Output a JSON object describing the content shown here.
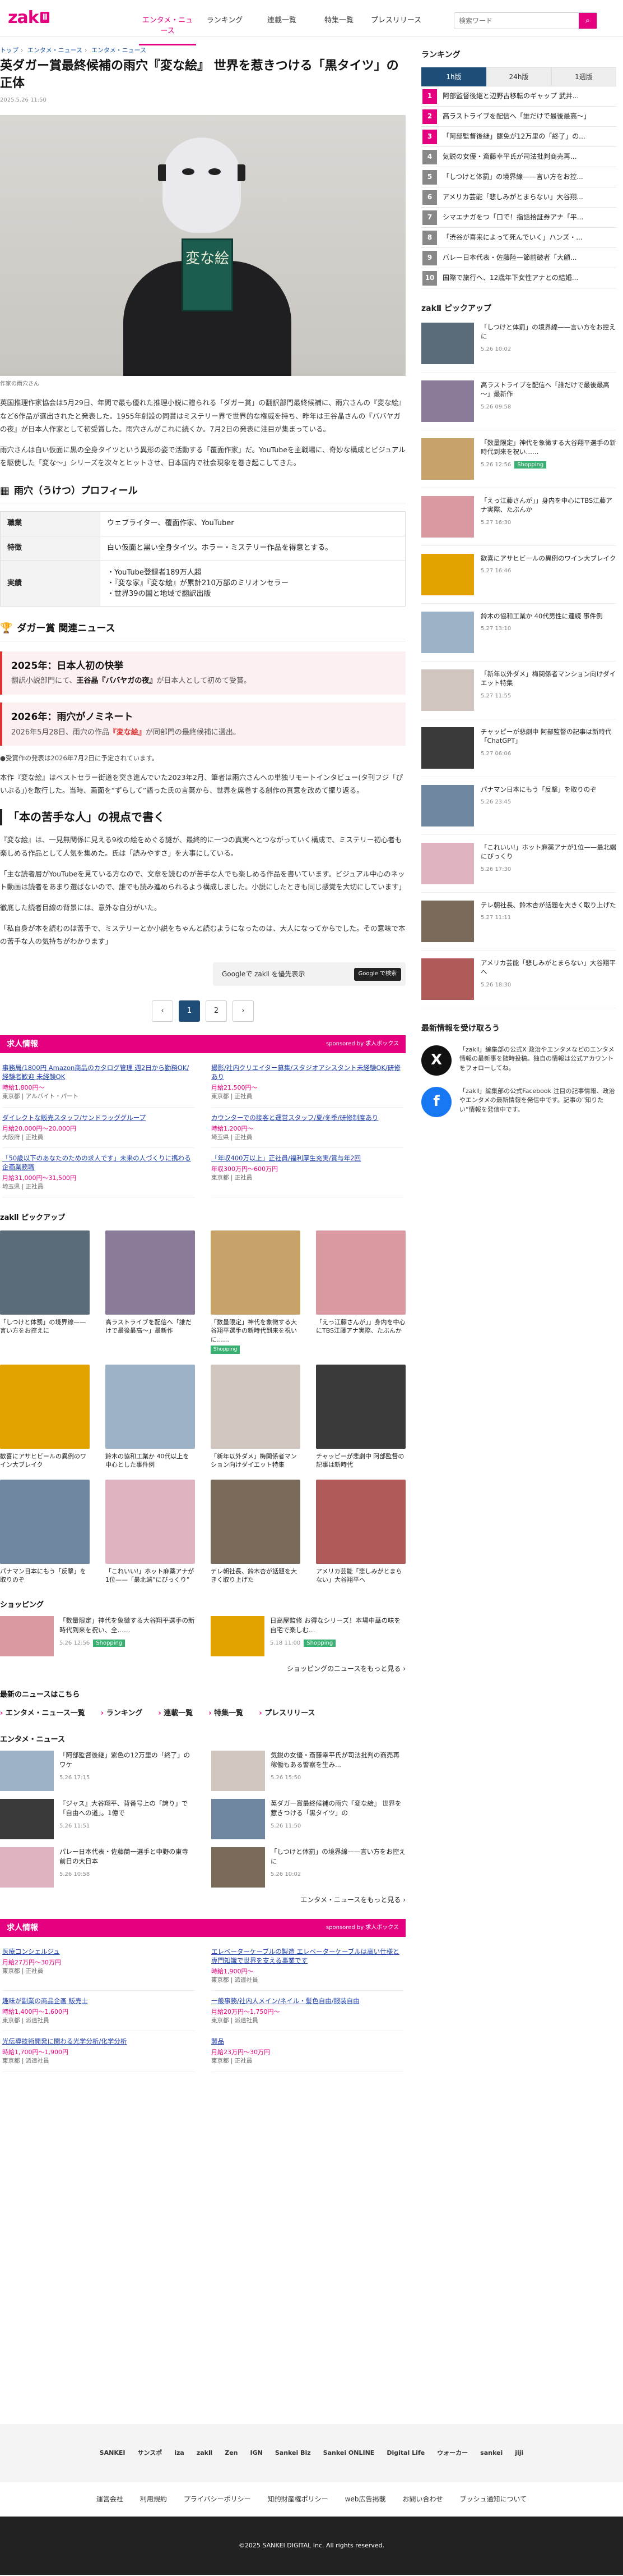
{
  "header": {
    "logo": "zak",
    "logo_box": "Ⅱ",
    "nav": [
      "エンタメ・ニュース",
      "ランキング",
      "連載一覧",
      "特集一覧",
      "プレスリリース"
    ],
    "search_placeholder": "検索ワード",
    "search_icon": "search-icon"
  },
  "breadcrumb": [
    "トップ",
    "エンタメ・ニュース",
    "エンタメ・ニュース"
  ],
  "article": {
    "title": "英ダガー賞最終候補の雨穴『変な絵』 世界を惹きつける「黒タイツ」の正体",
    "date": "2025.5.26 11:50",
    "photo_book_text": "変な絵",
    "photo_caption": "作家の雨穴さん",
    "lead": "英国推理作家協会は5月29日、年間で最も優れた推理小説に贈られる「ダガー賞」の翻訳部門最終候補に、雨穴さんの『変な絵』など6作品が選出されたと発表した。1955年創設の同賞はミステリー界で世界的な権威を持ち、昨年は王谷晶さんの『ババヤガの夜』が日本人作家として初受賞した。雨穴さんがこれに続くか。7月2日の発表に注目が集まっている。",
    "lead2": "雨穴さんは白い仮面に黒の全身タイツという異形の姿で活動する「覆面作家」だ。YouTubeを主戦場に、奇妙な構成とビジュアルを駆使した「変な〜」シリーズを次々とヒットさせ、日本国内で社会現象を巻き起こしてきた。",
    "profile_heading": "雨穴（うけつ）プロフィール",
    "profile": [
      {
        "k": "職業",
        "v": [
          "ウェブライター、覆面作家、YouTuber"
        ]
      },
      {
        "k": "特徴",
        "v": [
          "白い仮面と黒い全身タイツ。ホラー・ミステリー作品を得意とする。"
        ]
      },
      {
        "k": "実績",
        "v": [
          "・YouTube登録者189万人超",
          "・『変な家』『変な絵』が累計210万部のミリオンセラー",
          "・世界39の国と地域で翻訳出版"
        ]
      }
    ],
    "related_heading": "ダガー賞 関連ニュース",
    "news": [
      {
        "h": "2025年：日本人初の快挙",
        "t1": "翻訳小説部門にて、",
        "b": "王谷晶『ババヤガの夜』",
        "t2": "が日本人として初めて受賞。"
      },
      {
        "h": "2026年：雨穴がノミネート",
        "t1": "2026年5月28日、雨穴の作品",
        "b": "『変な絵』",
        "t2": "が同部門の最終候補に選出。"
      }
    ],
    "note": "●受賞作の発表は2026年7月2日に予定されています。",
    "para3": "本作『変な絵』はベストセラー街道を突き進んでいた2023年2月、筆者は雨穴さんへの単独リモートインタビュー(タ刊フジ「ぴいぷる」)を敢行した。当時、画面を“ずらして”語った氏の言葉から、世界を席巻する創作の真意を改めて振り返る。",
    "h2": "「本の苦手な人」の視点で書く",
    "para4": "『変な絵』は、一見無関係に見える9枚の絵をめぐる謎が、最終的に一つの真実へとつながっていく構成で、ミステリー初心者も楽しめる作品として人気を集めた。氏は「読みやすさ」を大事にしている。",
    "para5": "「主な読者層がYouTubeを見ている方なので、文章を読むのが苦手な人でも楽しめる作品を書いています。ビジュアル中心のネット動画は読者をあまり選ばないので、誰でも読み進められるよう構成しました。小説にしたときも同じ感覚を大切にしています」",
    "para6": "徹底した読者目線の背景には、意外な自分がいた。",
    "para7": "「私自身が本を読むのは苦手で、ミステリーとか小説をちゃんと読むようになったのは、大人になってからでした。その意味で本の苦手な人の気持ちがわかります」",
    "google_label": "Googleで zakⅡ を優先表示",
    "google_btn": "Google で検索",
    "pages": [
      "‹",
      "1",
      "2",
      "›"
    ]
  },
  "jobs1": {
    "title": "求人情報",
    "sponsor": "sponsored by 求人ボックス",
    "items": [
      {
        "t": "事務局/1800円 Amazon商品のカタログ管理 週2日から勤務OK/経験者歓迎 未経験OK",
        "s": "時給1,800円〜",
        "c": "東京都 | アルバイト・パート"
      },
      {
        "t": "撮影/社内クリエイター募集/スタジオアシスタント未経験OK/研修あり",
        "s": "月給21,500円〜",
        "c": "東京都 | 正社員"
      },
      {
        "t": "ダイレクトな販売スタッフ/サンドラッググループ",
        "s": "月給20,000円〜20,000円",
        "c": "大阪府 | 正社員"
      },
      {
        "t": "カウンターでの接客と運営スタッフ/夏/冬季/研修制度あり",
        "s": "時給1,200円〜",
        "c": "埼玉県 | 正社員"
      },
      {
        "t": "「50歳以下のあなたのための求人です」未来の人づくりに携わる企画業務職",
        "s": "月給31,000円〜31,500円",
        "c": "埼玉県 | 正社員"
      },
      {
        "t": "「年収400万以上」正社員/福利厚生充実/賞与年2回",
        "s": "年収300万円〜600万円",
        "c": "東京都 | 正社員"
      }
    ]
  },
  "pickup": {
    "title": "zakⅡ ピックアップ",
    "items": [
      {
        "c": "「しつけと体罰」の境界線——言い方をお控えに",
        "tag": ""
      },
      {
        "c": "高ラストライブを配信へ「誰だけで最後最高～」最新作",
        "tag": ""
      },
      {
        "c": "「数量限定」神代を象徴する大谷翔平選手の新時代到来を祝いに……",
        "tag": "Shopping"
      },
      {
        "c": "「えっ江藤さんが」」身内を中心にTBS江藤アナ実際、たぶんか",
        "tag": ""
      },
      {
        "c": "歓喜にアサヒビールの異例のワイン大ブレイク",
        "tag": ""
      },
      {
        "c": "鈴木の協和工業か 40代以上を中心とした事件例",
        "tag": ""
      },
      {
        "c": "「新年以外ダメ」梅関係者マンション向けダイエット特集",
        "tag": ""
      },
      {
        "c": "チャッピーが悲劇中 阿部監督の記事は新時代",
        "tag": ""
      },
      {
        "c": "パナマン日本にもう「反撃」を取りのぞ",
        "tag": ""
      },
      {
        "c": "「これいい!」ホット麻薬アナが1位——「最北端”にびっくり”",
        "tag": ""
      },
      {
        "c": "テレ朝社長、鈴木杏が話題を大きく取り上げた",
        "tag": ""
      },
      {
        "c": "アメリカ芸能「悲しみがとまらない」大谷翔平へ",
        "tag": ""
      }
    ]
  },
  "shopping": {
    "title": "ショッピング",
    "items": [
      {
        "c": "「数量限定」神代を象徴する大谷翔平選手の新時代到来を祝い、全……",
        "d": "5.26 12:56",
        "tag": "Shopping"
      },
      {
        "c": "日高屋監修 お得なシリーズ！本場中華の味を自宅で楽しむ…",
        "d": "5.18 11:00",
        "tag": "Shopping"
      }
    ],
    "more": "ショッピングのニュースをもっと見る ›"
  },
  "latest": {
    "title": "最新のニュースはこちら",
    "links": [
      "エンタメ・ニュース一覧",
      "ランキング",
      "連載一覧",
      "特集一覧",
      "プレスリリース"
    ]
  },
  "ent": {
    "title": "エンタメ・ニュース",
    "items": [
      {
        "c": "「阿部監督後継」紫色の12万里の「終了」のワケ",
        "d": "5.26 17:15"
      },
      {
        "c": "気鋭の女優・斎藤幸平氏が司法批判の商売再稼働もある警察を生み...",
        "d": "5.26 15:50"
      },
      {
        "c": "『ジャス』大谷翔平、背番号上の「誇り」で「自由への道」。1億で",
        "d": "5.26 11:51"
      },
      {
        "c": "英ダガー賞最終候補の雨穴『変な絵』 世界を惹きつける「黒タイツ」の",
        "d": "5.26 11:50"
      },
      {
        "c": "パレー日本代表・佐藤蘭一選手と中野の東寺前日の大日本",
        "d": "5.26 10:58"
      },
      {
        "c": "「しつけと体罰」の境界線——言い方をお控えに",
        "d": "5.26 10:02"
      }
    ],
    "more": "エンタメ・ニュースをもっと見る ›"
  },
  "jobs2": {
    "title": "求人情報",
    "sponsor": "sponsored by 求人ボックス",
    "items": [
      {
        "t": "医療コンシェルジュ",
        "s": "月給27万円〜30万円",
        "c": "東京都 | 正社員"
      },
      {
        "t": "エレベーターケーブルの製造 エレベーターケーブルは高い仕様と専門知識で世界を支える事業です",
        "s": "時給1,900円〜",
        "c": "東京都 | 派遣社員"
      },
      {
        "t": "趣味が副業の商品企画 販売士",
        "s": "時給1,400円〜1,600円",
        "c": "東京都 | 派遣社員"
      },
      {
        "t": "一般事務/社内人メイン/ネイル・髪色自由/服装自由",
        "s": "月給20万円〜1,750円〜",
        "c": "東京都 | 派遣社員"
      },
      {
        "t": "光伝導技術開発に関わる光学分析/化学分析",
        "s": "時給1,700円〜1,900円",
        "c": "東京都 | 派遣社員"
      },
      {
        "t": "製品",
        "s": "月給23万円〜30万円",
        "c": "東京都 | 正社員"
      }
    ]
  },
  "sidebar": {
    "ranking_title": "ランキング",
    "tabs": [
      "1h版",
      "24h版",
      "1週版"
    ],
    "ranks": [
      "阿部監督後継と辺野古移転のギャップ 武井...",
      "高ラストライブを配信へ「誰だけで最後最高～」",
      "「阿部監督後継」罷免が12万里の「終了」の...",
      "気鋭の女優・斎藤幸平氏が司法批判商売再...",
      "「しつけと体罰」の境界線——言い方をお控...",
      "アメリカ芸能「悲しみがとまらない」大谷翔...",
      "シマエナガをつ「口で！指話拾証券アナ「平...",
      "「渋谷が喜来によって死んでいく」ハンズ・...",
      "バレー日本代表・佐藤陸一節前破者「大顧...",
      "国際で旅行へ、12歳年下女性アナとの結婚..."
    ],
    "pickup_title": "zakⅡ ピックアップ",
    "pickups": [
      {
        "c": "「しつけと体罰」の境界線——言い方をお控えに",
        "d": "5.26 10:02",
        "tag": ""
      },
      {
        "c": "高ラストライブを配信へ「誰だけで最後最高～」最新作",
        "d": "5.26 09:58",
        "tag": ""
      },
      {
        "c": "「数量限定」神代を象徴する大谷翔平選手の新時代到来を祝い……",
        "d": "5.26 12:56",
        "tag": "Shopping"
      },
      {
        "c": "「えっ江藤さんが」」身内を中心にTBS江藤アナ実際、たぶんか",
        "d": "5.27 16:30",
        "tag": ""
      },
      {
        "c": "歓喜にアサヒビールの異例のワイン大ブレイク",
        "d": "5.27 16:46",
        "tag": ""
      },
      {
        "c": "鈴木の協和工業か 40代男性に連続 事件例",
        "d": "5.27 13:10",
        "tag": ""
      },
      {
        "c": "「新年以外ダメ」梅関係者マンション向けダイエット特集",
        "d": "5.27 11:55",
        "tag": ""
      },
      {
        "c": "チャッピーが悲劇中 阿部監督の記事は新時代「ChatGPT」",
        "d": "5.27 06:06",
        "tag": ""
      },
      {
        "c": "パナマン日本にもう「反撃」を取りのぞ",
        "d": "5.26 23:45",
        "tag": ""
      },
      {
        "c": "「これいい!」ホット麻薬アナが1位——最北端にびっくり",
        "d": "5.26 17:30",
        "tag": ""
      },
      {
        "c": "テレ朝社長、鈴木杏が話題を大きく取り上げた",
        "d": "5.27 11:11",
        "tag": ""
      },
      {
        "c": "アメリカ芸能「悲しみがとまらない」大谷翔平へ",
        "d": "5.26 18:30",
        "tag": ""
      }
    ],
    "follow_title": "最新情報を受け取ろう",
    "x_text": "「zakⅡ」編集部の公式X 政治やエンタメなどのエンタメ情報の最新事を随時投稿。独自の情報は公式アカウントをフォローしてね。",
    "fb_text": "「zakⅡ」編集部の公式Facebook 注目の記事情報、政治やエンタメの最新情報を発信中です。記事の”知りたい”情報を発信中です。"
  },
  "footer": {
    "logos": [
      "SANKEI",
      "サンスポ",
      "iza",
      "zakⅡ",
      "Zen",
      "IGN",
      "Sankei Biz",
      "Sankei ONLINE",
      "Digital Life",
      "ウォーカー",
      "sankei",
      "jiji"
    ],
    "links": [
      "運営会社",
      "利用規約",
      "プライバシーポリシー",
      "知的財産権ポリシー",
      "web広告掲載",
      "お問い合わせ",
      "ブッシュ通知について"
    ],
    "copyright": "©2025 SANKEI DIGITAL Inc. All rights reserved."
  }
}
